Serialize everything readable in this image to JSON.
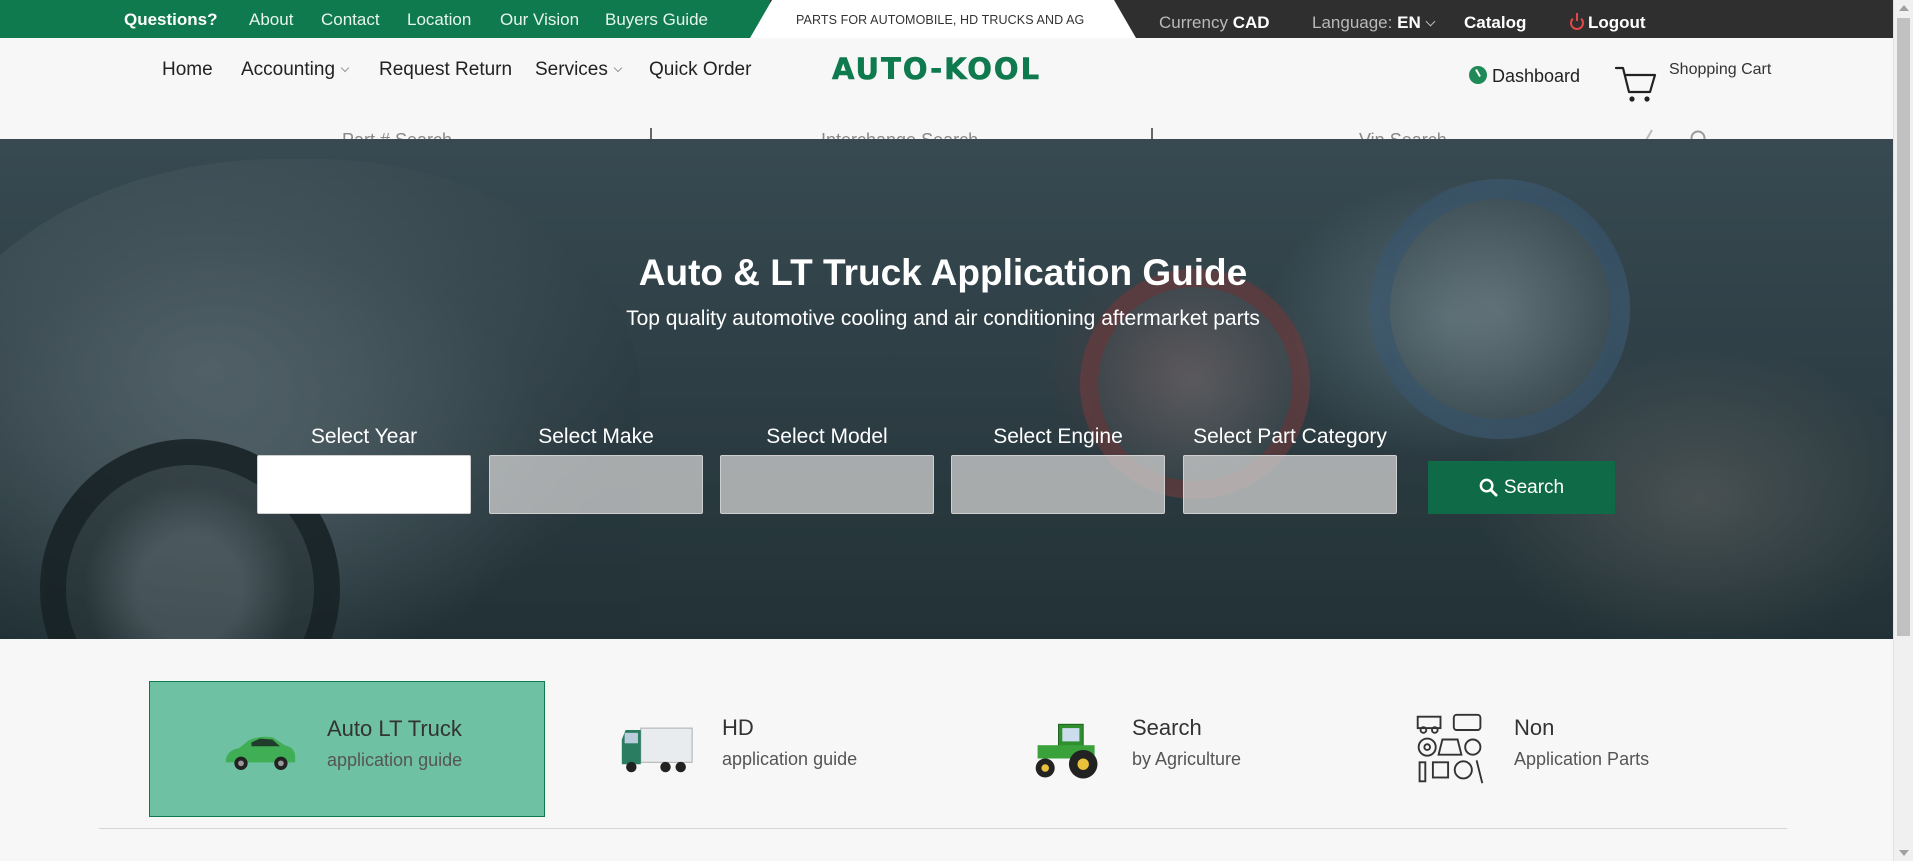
{
  "topbar": {
    "questions": "Questions?",
    "links": [
      "About",
      "Contact",
      "Location",
      "Our Vision",
      "Buyers Guide"
    ],
    "tagline": "PARTS FOR AUTOMOBILE, HD TRUCKS AND AG",
    "currency_label": "Currency",
    "currency_value": "CAD",
    "language_label": "Language:",
    "language_value": "EN",
    "catalog": "Catalog",
    "logout": "Logout"
  },
  "nav": {
    "home": "Home",
    "accounting": "Accounting",
    "request_return": "Request Return",
    "services": "Services",
    "quick_order": "Quick Order",
    "logo": "AUTO-KOOL",
    "dashboard": "Dashboard",
    "cart": "Shopping Cart"
  },
  "search_tabs": [
    "Part # Search",
    "Interchange Search",
    "Vin Search"
  ],
  "hero": {
    "title": "Auto & LT Truck Application Guide",
    "subtitle": "Top quality automotive cooling and air conditioning aftermarket parts",
    "selects": [
      {
        "label": "Select Year",
        "value": ""
      },
      {
        "label": "Select Make",
        "value": ""
      },
      {
        "label": "Select Model",
        "value": ""
      },
      {
        "label": "Select Engine",
        "value": ""
      },
      {
        "label": "Select Part Category",
        "value": ""
      }
    ],
    "search_button": "Search"
  },
  "categories": [
    {
      "title": "Auto LT Truck",
      "subtitle": "application guide",
      "icon": "green-car-icon",
      "active": true
    },
    {
      "title": "HD",
      "subtitle": "application guide",
      "icon": "truck-icon",
      "active": false
    },
    {
      "title": "Search",
      "subtitle": "by Agriculture",
      "icon": "tractor-icon",
      "active": false
    },
    {
      "title": "Non",
      "subtitle": "Application Parts",
      "icon": "parts-icon",
      "active": false
    }
  ],
  "colors": {
    "brand_green": "#0f7a4e",
    "active_card": "#6fc1a3",
    "topbar_dark": "#2f2f2f",
    "button_green": "#0f6b47"
  }
}
